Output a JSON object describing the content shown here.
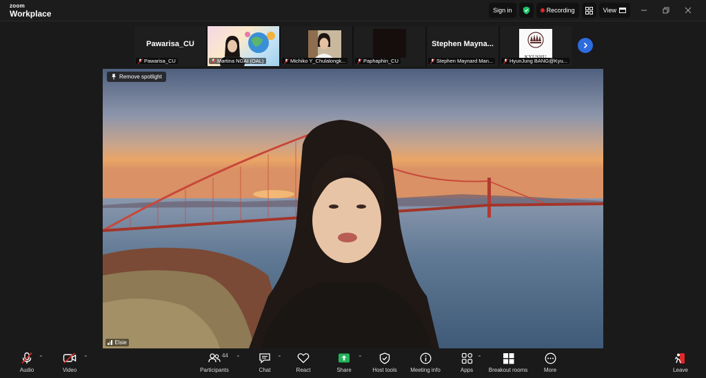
{
  "app": {
    "logo_top": "zoom",
    "logo_bottom": "Workplace"
  },
  "titlebar": {
    "sign_in": "Sign in",
    "recording": "Recording",
    "view": "View"
  },
  "gallery": [
    {
      "big_name": "Pawarisa_CU",
      "label": "Pawarisa_CU",
      "has_video": false
    },
    {
      "big_name": "",
      "label": "Martina NGAI (OAL)",
      "has_video": true
    },
    {
      "big_name": "",
      "label": "Michiko Y_Chulalongk...",
      "has_video": true
    },
    {
      "big_name": "",
      "label": "Paphaphin_CU",
      "has_video": true
    },
    {
      "big_name": "Stephen  Mayna...",
      "label": "Stephen Maynard Man...",
      "has_video": false
    },
    {
      "big_name": "",
      "label": "HyunJung BANG@Kyu...",
      "has_video": true,
      "logo_text": "KYUSHU"
    }
  ],
  "spotlight": {
    "remove_label": "Remove spotlight",
    "name": "Elsie"
  },
  "toolbar": {
    "audio": "Audio",
    "video": "Video",
    "participants": "Participants",
    "participants_count": "44",
    "chat": "Chat",
    "react": "React",
    "share": "Share",
    "host_tools": "Host tools",
    "meeting_info": "Meeting info",
    "apps": "Apps",
    "breakout": "Breakout rooms",
    "more": "More",
    "leave": "Leave"
  },
  "colors": {
    "accent_blue": "#2d6cdf",
    "share_green": "#23b35a",
    "leave_red": "#e02828",
    "shield_green": "#1ec26b"
  }
}
